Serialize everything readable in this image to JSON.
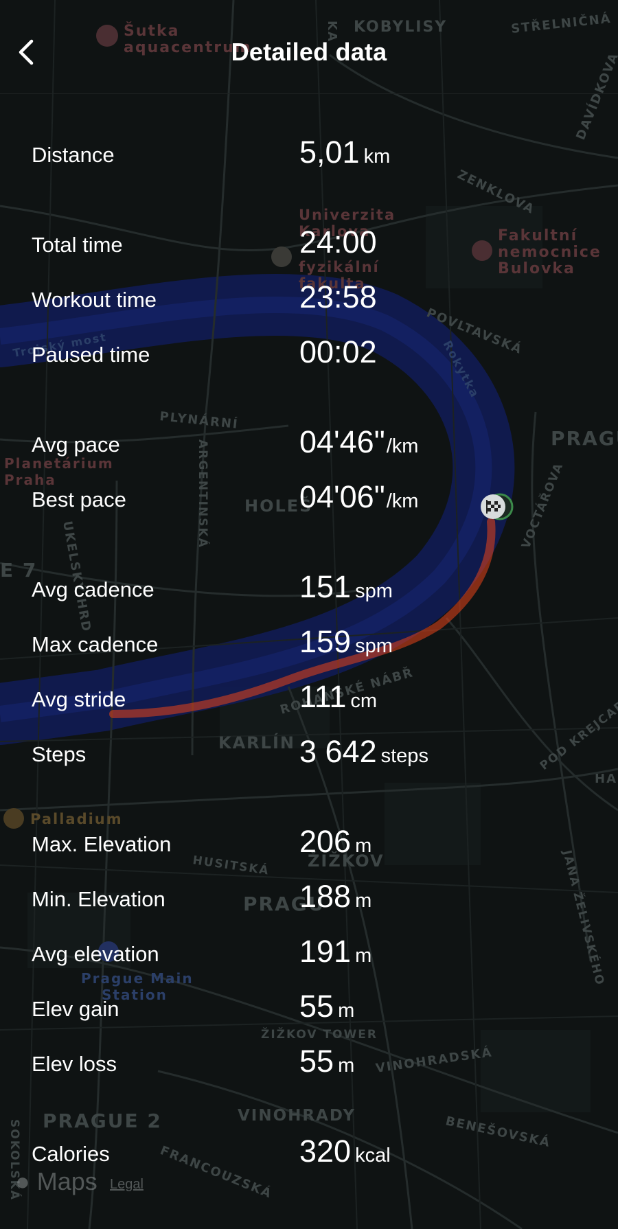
{
  "header": {
    "title": "Detailed data"
  },
  "stats": [
    {
      "id": "distance",
      "label": "Distance",
      "value": "5,01",
      "unit": "km"
    },
    {
      "id": "total-time",
      "label": "Total time",
      "value": "24:00",
      "unit": ""
    },
    {
      "id": "workout-time",
      "label": "Workout time",
      "value": "23:58",
      "unit": ""
    },
    {
      "id": "paused-time",
      "label": "Paused time",
      "value": "00:02",
      "unit": ""
    },
    {
      "id": "avg-pace",
      "label": "Avg pace",
      "value": "04'46\"",
      "unit": "/km"
    },
    {
      "id": "best-pace",
      "label": "Best pace",
      "value": "04'06\"",
      "unit": "/km"
    },
    {
      "id": "avg-cadence",
      "label": "Avg cadence",
      "value": "151",
      "unit": "spm"
    },
    {
      "id": "max-cadence",
      "label": "Max cadence",
      "value": "159",
      "unit": "spm"
    },
    {
      "id": "avg-stride",
      "label": "Avg stride",
      "value": "111",
      "unit": "cm"
    },
    {
      "id": "steps",
      "label": "Steps",
      "value": "3 642",
      "unit": "steps"
    },
    {
      "id": "max-elevation",
      "label": "Max. Elevation",
      "value": "206",
      "unit": "m"
    },
    {
      "id": "min-elevation",
      "label": "Min. Elevation",
      "value": "188",
      "unit": "m"
    },
    {
      "id": "avg-elevation",
      "label": "Avg elevation",
      "value": "191",
      "unit": "m"
    },
    {
      "id": "elev-gain",
      "label": "Elev gain",
      "value": "55",
      "unit": "m"
    },
    {
      "id": "elev-loss",
      "label": "Elev loss",
      "value": "55",
      "unit": "m"
    },
    {
      "id": "calories",
      "label": "Calories",
      "value": "320",
      "unit": "kcal"
    }
  ],
  "map": {
    "labels": {
      "sutka": "Šutka",
      "aquacentrum": "aquacentrum",
      "kobylisy": "KOBYLISY",
      "strelnicna": "STŘELNIČNÁ",
      "davidkova": "DAVÍDKOVA",
      "zenklova": "ZENKLOVA",
      "univerzita": "Univerzita",
      "karlova": "Karlova",
      "fyzikalni": "fyzikální",
      "fakulta": "fakulta",
      "fakultni": "Fakultní",
      "nemocnice": "nemocnice",
      "bulovka": "Bulovka",
      "povltavska": "POVLTAVSKÁ",
      "rokytka": "Rokytka",
      "trojsky": "Trojský most",
      "plynarni": "PLYNÁRNÍ",
      "argentinska": "ARGENTINSKÁ",
      "prague_e": "PRAGU",
      "planetarium": "Planetárium",
      "praha": "Praha",
      "holesovice": "HOLEŠ",
      "voctarova": "VOCTÁŘOVA",
      "ukelsky": "UKELSKÝ HRD",
      "e7": "E 7",
      "rohanske": "ROHANSKÉ NÁBŘ",
      "karlin": "KARLÍN",
      "pod_krejcarkem": "POD KREJCAR",
      "ha": "HA",
      "palladium": "Palladium",
      "husitska": "HUSITSKÁ",
      "zizkov": "ŽIŽKOV",
      "prague_c": "PRAGU",
      "jana_zelivskeho": "JANA ŽELIVSKÉHO",
      "prague_main": "Prague Main",
      "station": "Station",
      "zizkov_tower": "ŽIŽKOV TOWER",
      "vinohradska": "VINOHRADSKÁ",
      "prague2": "PRAGUE 2",
      "vinohrady": "VINOHRADY",
      "benesovska": "BENEŠOVSKÁ",
      "sokolska": "SOKOLSKÁ",
      "francouzska": "FRANCOUZSKÁ",
      "ka": "KA"
    },
    "route_color": "#e8441a",
    "river_color": "#101c58"
  },
  "footer": {
    "maps_logo": " Maps",
    "legal": "Legal"
  }
}
